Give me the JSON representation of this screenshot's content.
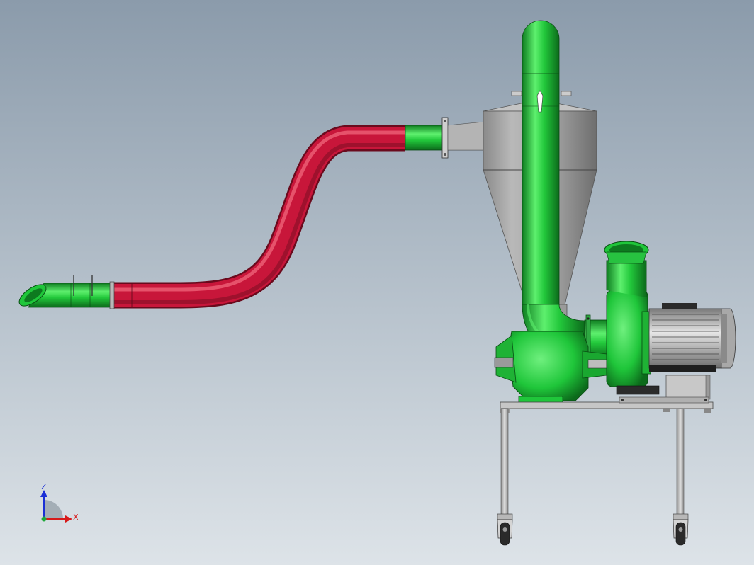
{
  "viewport": {
    "background_top": "#8a9aaa",
    "background_bottom": "#d6dde3"
  },
  "colors": {
    "green": "#1fc63a",
    "green_dark": "#0d7a1f",
    "green_light": "#6ff07e",
    "red": "#c8163a",
    "red_dark": "#6e0a1e",
    "red_light": "#f05a72",
    "steel": "#9c9c9c",
    "steel_dark": "#5e5e5e",
    "steel_light": "#d2d2d2",
    "frame": "#c4c4c4"
  },
  "model": {
    "parts": [
      "inlet-nozzle",
      "flexible-hose",
      "cyclone-inlet-pipe",
      "cyclone-separator",
      "vertical-riser-pipe",
      "rotary-airlock-valve",
      "centrifugal-blower",
      "electric-motor",
      "base-frame",
      "caster-wheels"
    ]
  },
  "triad": {
    "z_label": "Z",
    "x_label": "X",
    "z_color": "#1a2fd6",
    "x_color": "#d61a1a"
  }
}
